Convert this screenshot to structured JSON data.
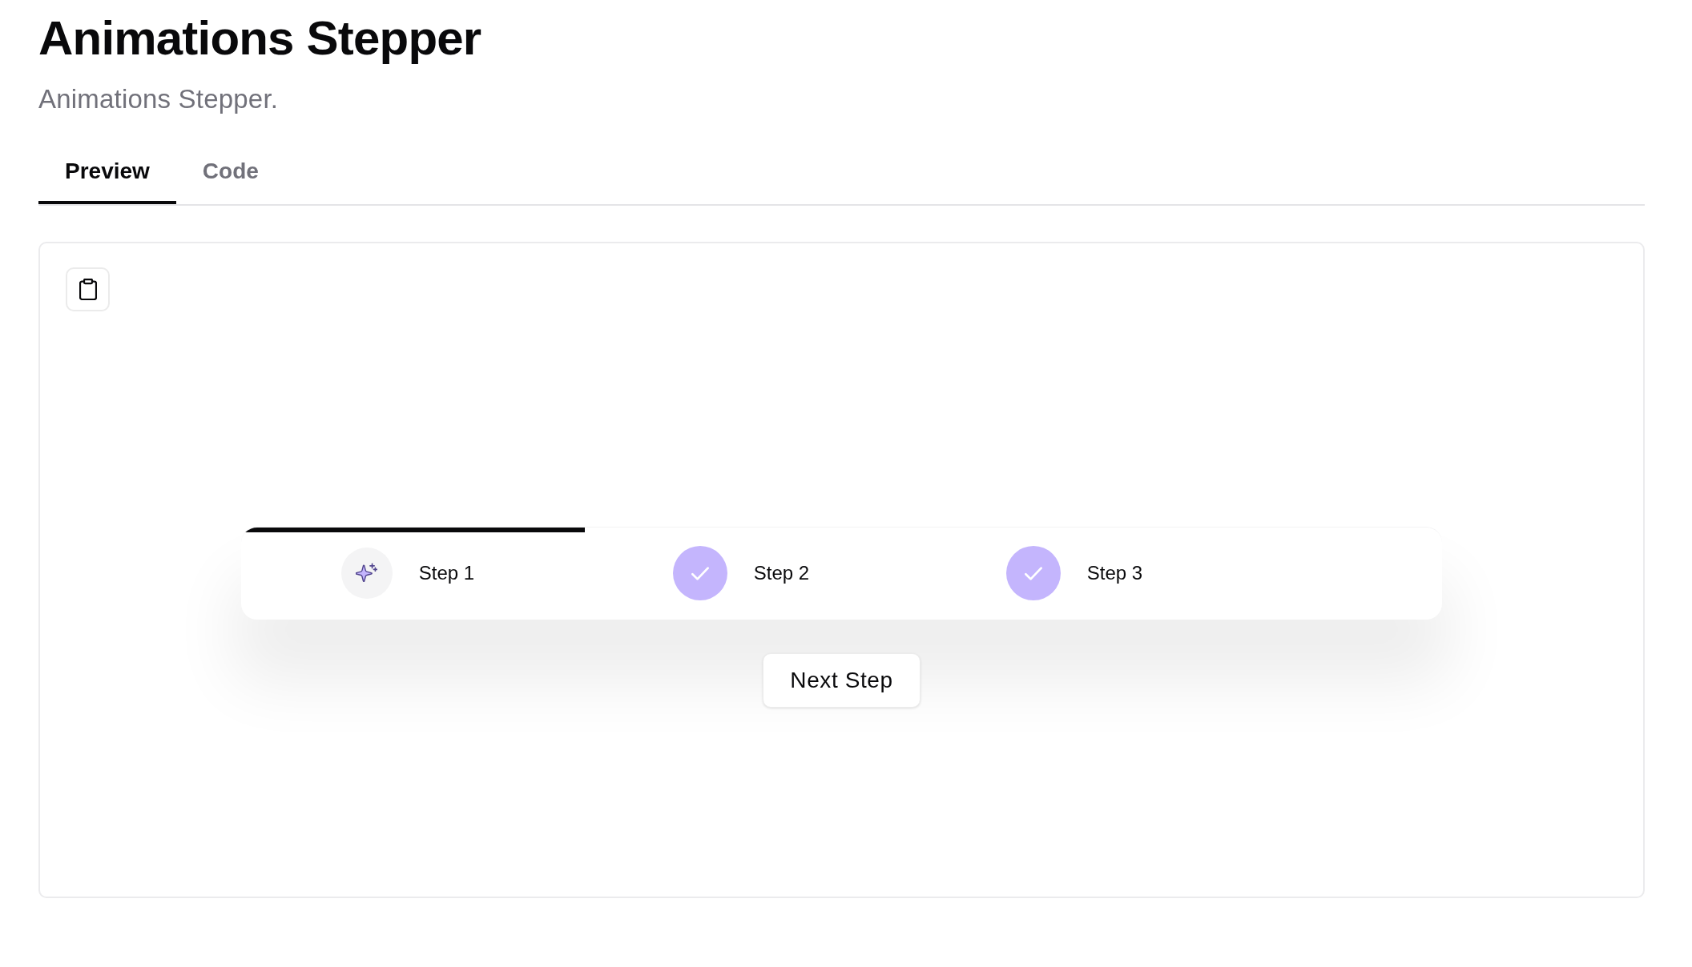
{
  "page": {
    "title": "Animations Stepper",
    "description": "Animations Stepper."
  },
  "tabs": [
    {
      "label": "Preview",
      "selected": true
    },
    {
      "label": "Code",
      "selected": false
    }
  ],
  "preview": {
    "stepper": {
      "progress": {
        "level": 0.286
      },
      "steps": [
        {
          "label": "Step 1",
          "completed": false
        },
        {
          "label": "Step 2",
          "completed": true
        },
        {
          "label": "Step 3",
          "completed": true
        }
      ]
    },
    "next_button": {
      "label": "Next Step"
    }
  }
}
